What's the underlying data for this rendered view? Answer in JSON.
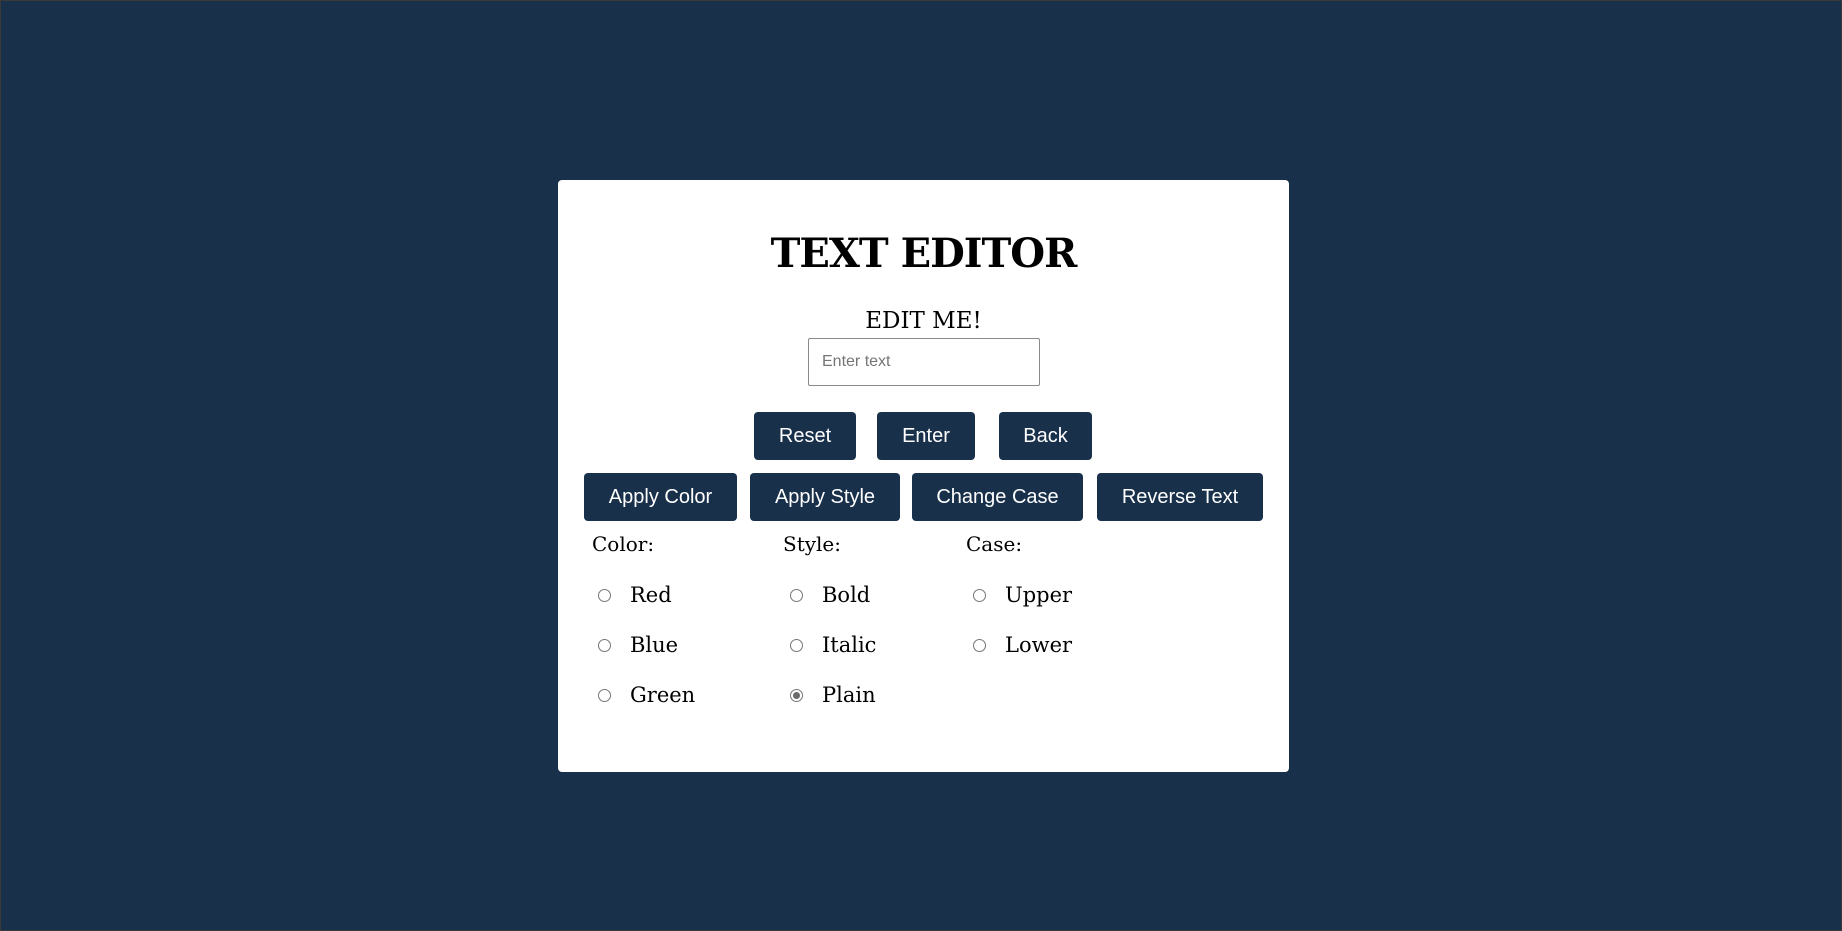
{
  "app": {
    "title": "TEXT EDITOR",
    "display_text": "EDIT ME!"
  },
  "input": {
    "value": "",
    "placeholder": "Enter text"
  },
  "buttons": {
    "reset": "Reset",
    "enter": "Enter",
    "back": "Back",
    "apply_color": "Apply Color",
    "apply_style": "Apply Style",
    "change_case": "Change Case",
    "reverse_text": "Reverse Text"
  },
  "options": {
    "color": {
      "label": "Color:",
      "items": [
        "Red",
        "Blue",
        "Green"
      ],
      "selected": null
    },
    "style": {
      "label": "Style:",
      "items": [
        "Bold",
        "Italic",
        "Plain"
      ],
      "selected": "Plain"
    },
    "case": {
      "label": "Case:",
      "items": [
        "Upper",
        "Lower"
      ],
      "selected": null
    }
  },
  "colors": {
    "background": "#18304a",
    "button": "#18304a",
    "card": "#ffffff"
  }
}
